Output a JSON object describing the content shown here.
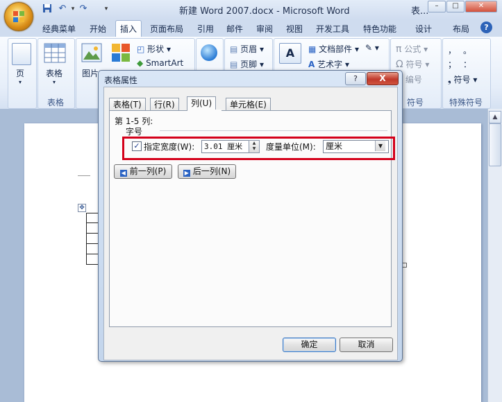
{
  "window": {
    "title": "新建 Word 2007.docx - Microsoft Word",
    "title_truncated": "表...",
    "controls": [
      "–",
      "□",
      "✕"
    ]
  },
  "quick_access": {
    "items": [
      "save-icon",
      "undo-icon",
      "redo-icon",
      "customize-icon"
    ]
  },
  "ribbon": {
    "tabs": [
      "经典菜单",
      "开始",
      "插入",
      "页面布局",
      "引用",
      "邮件",
      "审阅",
      "视图",
      "开发工具",
      "特色功能",
      "设计",
      "布局"
    ],
    "active_tab": "插入",
    "groups": {
      "pages": {
        "button": "页",
        "label": ""
      },
      "tables": {
        "button": "表格",
        "label": "表格"
      },
      "illustrations": {
        "picture": "图片",
        "clipart": "剪贴画",
        "shapes": "形状",
        "smartart": "SmartArt"
      },
      "links": {
        "button": "链接"
      },
      "header_footer": {
        "header": "页眉",
        "footer": "页脚"
      },
      "text": {
        "textbox": "文本框",
        "quick_parts": "文档部件",
        "wordart": "艺术字"
      },
      "symbols": {
        "formula": "公式",
        "symbol": "符号",
        "number": "编号",
        "label": "符号"
      },
      "special_symbols": {
        "chars": [
          "，",
          "。",
          "；",
          "：",
          "！",
          "？"
        ],
        "symbol": "符号",
        "label": "特殊符号"
      }
    }
  },
  "dialog": {
    "title": "表格属性",
    "help": "?",
    "close": "X",
    "tabs": [
      "表格(T)",
      "行(R)",
      "列(U)",
      "单元格(E)"
    ],
    "active_tab": "列(U)",
    "column_range": "第 1-5 列:",
    "section_label": "字号",
    "specify_width": {
      "label": "指定宽度(W):",
      "checked": true
    },
    "width_value": "3.01 厘米",
    "unit_label": "度量单位(M):",
    "unit_value": "厘米",
    "prev_column": "前一列(P)",
    "next_column": "后一列(N)",
    "ok": "确定",
    "cancel": "取消"
  }
}
